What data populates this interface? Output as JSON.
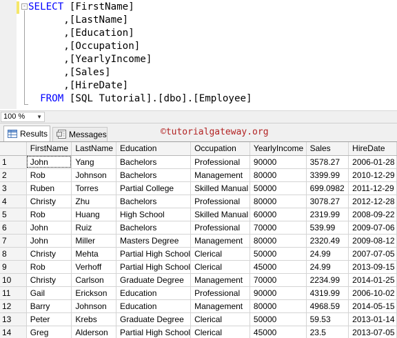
{
  "editor": {
    "collapse_glyph": "-",
    "lines": [
      {
        "indent": "",
        "kw": "SELECT",
        "rest": " [FirstName]"
      },
      {
        "indent": "      ",
        "kw": "",
        "rest": ",[LastName]"
      },
      {
        "indent": "      ",
        "kw": "",
        "rest": ",[Education]"
      },
      {
        "indent": "      ",
        "kw": "",
        "rest": ",[Occupation]"
      },
      {
        "indent": "      ",
        "kw": "",
        "rest": ",[YearlyIncome]"
      },
      {
        "indent": "      ",
        "kw": "",
        "rest": ",[Sales]"
      },
      {
        "indent": "      ",
        "kw": "",
        "rest": ",[HireDate]"
      },
      {
        "indent": "  ",
        "kw": "FROM",
        "rest": " [SQL Tutorial].[dbo].[Employee]"
      }
    ]
  },
  "zoom": {
    "value": "100 %",
    "arrow_icon": "chevron-down-icon"
  },
  "tabs": [
    {
      "label": "Results",
      "icon": "grid-icon"
    },
    {
      "label": "Messages",
      "icon": "messages-icon"
    }
  ],
  "watermark": "©tutorialgateway.org",
  "grid": {
    "columns": [
      "",
      "FirstName",
      "LastName",
      "Education",
      "Occupation",
      "YearlyIncome",
      "Sales",
      "HireDate"
    ],
    "rows": [
      [
        "1",
        "John",
        "Yang",
        "Bachelors",
        "Professional",
        "90000",
        "3578.27",
        "2006-01-28"
      ],
      [
        "2",
        "Rob",
        "Johnson",
        "Bachelors",
        "Management",
        "80000",
        "3399.99",
        "2010-12-29"
      ],
      [
        "3",
        "Ruben",
        "Torres",
        "Partial College",
        "Skilled Manual",
        "50000",
        "699.0982",
        "2011-12-29"
      ],
      [
        "4",
        "Christy",
        "Zhu",
        "Bachelors",
        "Professional",
        "80000",
        "3078.27",
        "2012-12-28"
      ],
      [
        "5",
        "Rob",
        "Huang",
        "High School",
        "Skilled Manual",
        "60000",
        "2319.99",
        "2008-09-22"
      ],
      [
        "6",
        "John",
        "Ruiz",
        "Bachelors",
        "Professional",
        "70000",
        "539.99",
        "2009-07-06"
      ],
      [
        "7",
        "John",
        "Miller",
        "Masters Degree",
        "Management",
        "80000",
        "2320.49",
        "2009-08-12"
      ],
      [
        "8",
        "Christy",
        "Mehta",
        "Partial High School",
        "Clerical",
        "50000",
        "24.99",
        "2007-07-05"
      ],
      [
        "9",
        "Rob",
        "Verhoff",
        "Partial High School",
        "Clerical",
        "45000",
        "24.99",
        "2013-09-15"
      ],
      [
        "10",
        "Christy",
        "Carlson",
        "Graduate Degree",
        "Management",
        "70000",
        "2234.99",
        "2014-01-25"
      ],
      [
        "11",
        "Gail",
        "Erickson",
        "Education",
        "Professional",
        "90000",
        "4319.99",
        "2006-10-02"
      ],
      [
        "12",
        "Barry",
        "Johnson",
        "Education",
        "Management",
        "80000",
        "4968.59",
        "2014-05-15"
      ],
      [
        "13",
        "Peter",
        "Krebs",
        "Graduate Degree",
        "Clerical",
        "50000",
        "59.53",
        "2013-01-14"
      ],
      [
        "14",
        "Greg",
        "Alderson",
        "Partial High School",
        "Clerical",
        "45000",
        "23.5",
        "2013-07-05"
      ]
    ]
  }
}
